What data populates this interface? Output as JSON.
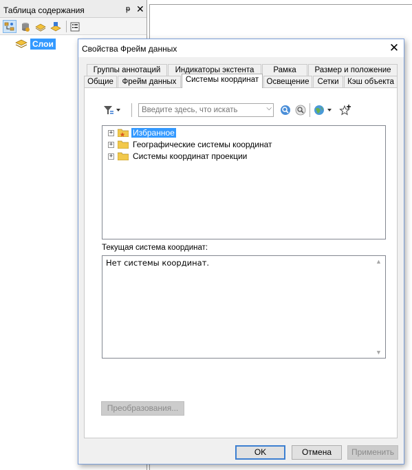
{
  "toc": {
    "title": "Таблица содержания",
    "pin_glyph": "ᵽ",
    "close_glyph": "✕",
    "toolbar": [
      {
        "name": "list-by-drawing-order-icon",
        "active": true
      },
      {
        "name": "list-by-source-icon",
        "active": false
      },
      {
        "name": "list-by-visibility-icon",
        "active": false
      },
      {
        "name": "list-by-selection-icon",
        "active": false
      },
      {
        "name": "options-icon",
        "active": false
      }
    ],
    "layers_label": "Слои"
  },
  "dialog": {
    "title": "Свойства Фрейм данных",
    "close_glyph": "✕",
    "tabs_row1": [
      "Группы аннотаций",
      "Индикаторы экстента",
      "Рамка",
      "Размер и положение"
    ],
    "tabs_row2": [
      "Общие",
      "Фрейм данных",
      "Системы координат",
      "Освещение",
      "Сетки",
      "Кэш объекта"
    ],
    "active_tab": "Системы координат",
    "search": {
      "placeholder": "Введите здесь, что искать",
      "dropdown_glyph": "⌵"
    },
    "tree": [
      {
        "label": "Избранное",
        "selected": true,
        "favorite": true
      },
      {
        "label": "Географические системы координат",
        "selected": false,
        "favorite": false
      },
      {
        "label": "Системы координат проекции",
        "selected": false,
        "favorite": false
      }
    ],
    "tree_expander_glyph": "+",
    "current_label": "Текущая система координат:",
    "current_value": "Нет системы координат.",
    "scroll_up_glyph": "▲",
    "scroll_down_glyph": "▼",
    "transform_button": "Преобразования...",
    "ok_button": "OK",
    "cancel_button": "Отмена",
    "apply_button": "Применить"
  },
  "colors": {
    "selection": "#3399ff",
    "dialog_border": "#7a9ed8",
    "default_button_border": "#3c7fd1"
  }
}
